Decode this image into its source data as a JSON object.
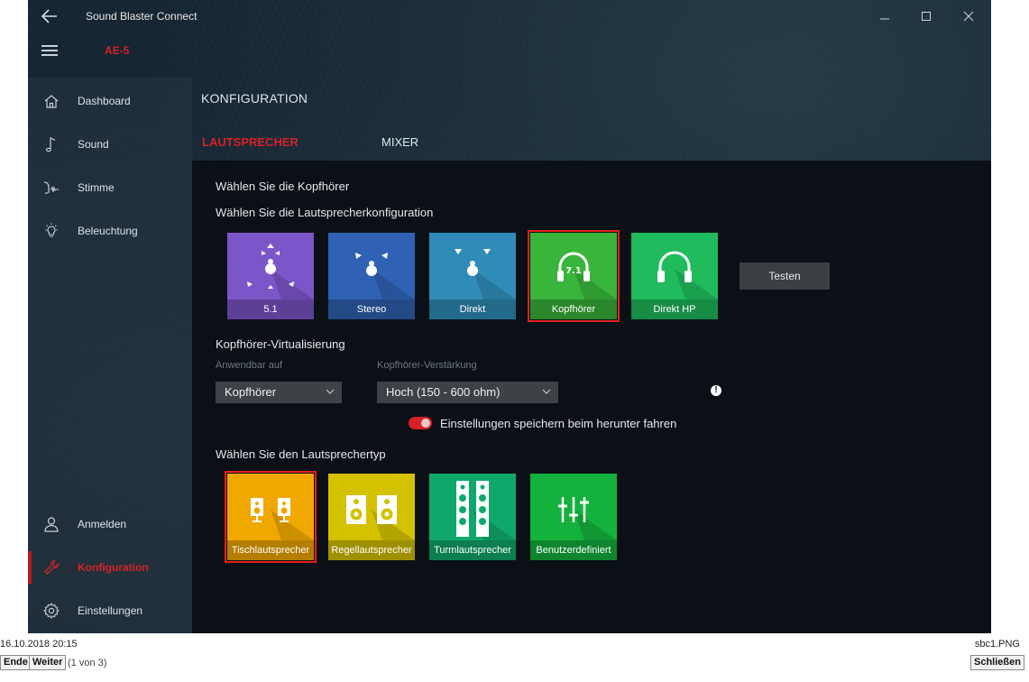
{
  "window": {
    "title": "Sound Blaster Connect",
    "device": "AE-5"
  },
  "sidebar": {
    "items": [
      {
        "label": "Dashboard",
        "icon": "home-icon"
      },
      {
        "label": "Sound",
        "icon": "music-note-icon"
      },
      {
        "label": "Stimme",
        "icon": "voice-icon"
      },
      {
        "label": "Beleuchtung",
        "icon": "lightbulb-icon"
      },
      {
        "label": "Anmelden",
        "icon": "user-icon"
      },
      {
        "label": "Konfiguration",
        "icon": "wrench-icon",
        "active": true
      },
      {
        "label": "Einstellungen",
        "icon": "gear-icon"
      }
    ]
  },
  "main": {
    "title": "KONFIGURATION",
    "tabs": [
      {
        "label": "LAUTSPRECHER",
        "active": true
      },
      {
        "label": "MIXER",
        "active": false
      }
    ],
    "headphones_heading": "Wählen Sie die Kopfhörer",
    "speaker_config_heading": "Wählen Sie die Lautsprecherkonfiguration",
    "config_tiles": [
      {
        "label": "5.1",
        "color": "#7b56c9",
        "icon": "surround-51-icon"
      },
      {
        "label": "Stereo",
        "color": "#2f62b4",
        "icon": "stereo-icon"
      },
      {
        "label": "Direkt",
        "color": "#2f8cb8",
        "icon": "direct-icon"
      },
      {
        "label": "Kopfhörer",
        "color": "#38b53a",
        "icon": "headphones-71-icon",
        "selected": true
      },
      {
        "label": "Direkt HP",
        "color": "#1fbb5c",
        "icon": "headphones-icon"
      }
    ],
    "test_button": "Testen",
    "virtualization_heading": "Kopfhörer-Virtualisierung",
    "applicable_label": "Anwendbar auf",
    "applicable_value": "Kopfhörer",
    "gain_label": "Kopfhörer-Verstärkung",
    "gain_value": "Hoch (150 - 600 ohm)",
    "save_on_shutdown_label": "Einstellungen speichern beim herunter fahren",
    "save_on_shutdown_enabled": true,
    "speaker_type_heading": "Wählen Sie den Lautsprechertyp",
    "type_tiles": [
      {
        "label": "Tischlautsprecher",
        "color": "#f0a800",
        "icon": "desktop-speakers-icon",
        "selected": true
      },
      {
        "label": "Regellautsprecher",
        "color": "#d4c100",
        "icon": "bookshelf-speakers-icon"
      },
      {
        "label": "Turmlautsprecher",
        "color": "#10a86a",
        "icon": "tower-speakers-icon"
      },
      {
        "label": "Benutzerdefiniert",
        "color": "#14b23c",
        "icon": "equalizer-icon"
      }
    ]
  },
  "viewer": {
    "datetime": "16.10.2018 20:15",
    "filename": "sbc1.PNG",
    "end_button": "Ende",
    "next_button": "Weiter",
    "page_info": "(1 von 3)",
    "close_button": "Schließen"
  }
}
